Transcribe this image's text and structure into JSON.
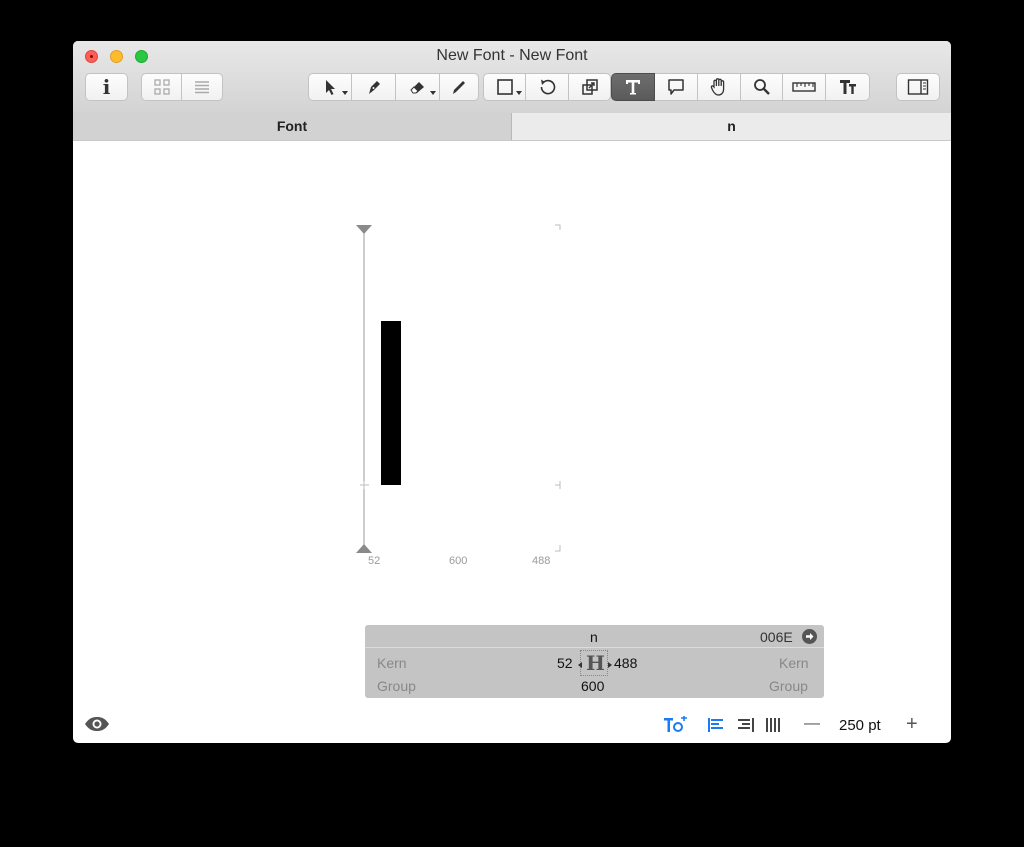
{
  "window": {
    "title": "New Font - New Font"
  },
  "toolbar": {
    "info_icon": "i",
    "buttons": [
      "select-tool",
      "pen-tool",
      "eraser-tool",
      "pencil-tool",
      "rectangle-tool",
      "rotate-tool",
      "scale-tool",
      "text-tool",
      "annotation-tool",
      "hand-tool",
      "zoom-tool",
      "measurement-tool",
      "text-preview-tool",
      "sidebar-toggle"
    ],
    "active_tool": "text-tool"
  },
  "tabs": [
    {
      "label": "Font"
    },
    {
      "label": "n"
    }
  ],
  "glyph_metrics": {
    "lsb": "52",
    "width": "600",
    "rsb": "488"
  },
  "info_panel": {
    "glyph_name": "n",
    "unicode": "006E",
    "left_kern_label": "Kern",
    "right_kern_label": "Kern",
    "left_group_label": "Group",
    "right_group_label": "Group",
    "lsb": "52",
    "rsb": "488",
    "width": "600",
    "sample_glyph": "H"
  },
  "footer": {
    "zoom": "250 pt",
    "minus": "—",
    "plus": "+"
  },
  "colors": {
    "accent_blue": "#1a7bf2",
    "active_tool_bg": "#5f5f5f",
    "close": "#fc5f57",
    "minimize": "#fdbc2e",
    "maximize": "#28c840"
  }
}
